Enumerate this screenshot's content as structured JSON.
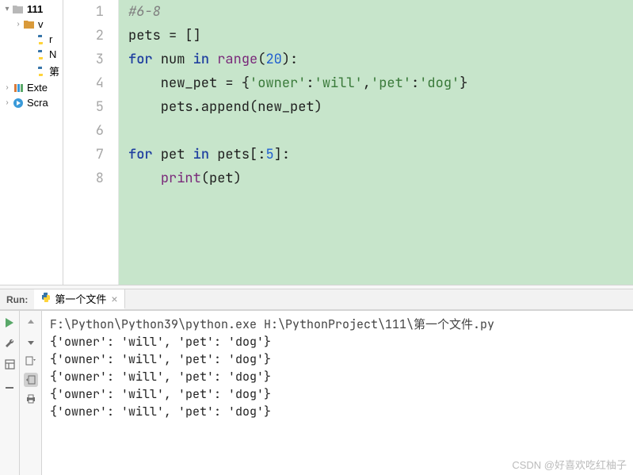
{
  "sidebar": {
    "items": [
      {
        "label": "111",
        "icon": "folder-open",
        "chev": "▾",
        "bold": true
      },
      {
        "label": "v",
        "icon": "folder-orange",
        "chev": "›",
        "indent": 1
      },
      {
        "label": "r",
        "icon": "python",
        "indent": 2
      },
      {
        "label": "N",
        "icon": "python",
        "indent": 2
      },
      {
        "label": "第",
        "icon": "python",
        "indent": 2
      },
      {
        "label": "Exte",
        "icon": "lib",
        "chev": "›"
      },
      {
        "label": "Scra",
        "icon": "scratch",
        "chev": "›"
      }
    ]
  },
  "editor": {
    "lines": [
      {
        "n": "1",
        "tokens": [
          {
            "t": "#6-8",
            "c": "c-comment"
          }
        ]
      },
      {
        "n": "2",
        "tokens": [
          {
            "t": "pets ",
            "c": "c-text"
          },
          {
            "t": "= []",
            "c": "c-punct"
          }
        ]
      },
      {
        "n": "3",
        "tokens": [
          {
            "t": "for ",
            "c": "c-kw"
          },
          {
            "t": "num ",
            "c": "c-text"
          },
          {
            "t": "in ",
            "c": "c-kw"
          },
          {
            "t": "range",
            "c": "c-builtin"
          },
          {
            "t": "(",
            "c": "c-punct"
          },
          {
            "t": "20",
            "c": "c-num"
          },
          {
            "t": "):",
            "c": "c-punct"
          }
        ]
      },
      {
        "n": "4",
        "tokens": [
          {
            "t": "    new_pet ",
            "c": "c-text"
          },
          {
            "t": "= {",
            "c": "c-punct"
          },
          {
            "t": "'owner'",
            "c": "c-str"
          },
          {
            "t": ":",
            "c": "c-punct"
          },
          {
            "t": "'will'",
            "c": "c-str"
          },
          {
            "t": ",",
            "c": "c-punct"
          },
          {
            "t": "'pet'",
            "c": "c-str"
          },
          {
            "t": ":",
            "c": "c-punct"
          },
          {
            "t": "'dog'",
            "c": "c-str"
          },
          {
            "t": "}",
            "c": "c-punct"
          }
        ]
      },
      {
        "n": "5",
        "tokens": [
          {
            "t": "    pets.append(new_pet)",
            "c": "c-text"
          }
        ]
      },
      {
        "n": "6",
        "tokens": []
      },
      {
        "n": "7",
        "tokens": [
          {
            "t": "for ",
            "c": "c-kw"
          },
          {
            "t": "pet ",
            "c": "c-text"
          },
          {
            "t": "in ",
            "c": "c-kw"
          },
          {
            "t": "pets[:",
            "c": "c-text"
          },
          {
            "t": "5",
            "c": "c-num"
          },
          {
            "t": "]:",
            "c": "c-punct"
          }
        ]
      },
      {
        "n": "8",
        "tokens": [
          {
            "t": "    ",
            "c": "c-text"
          },
          {
            "t": "print",
            "c": "c-builtin"
          },
          {
            "t": "(pet)",
            "c": "c-text"
          }
        ]
      }
    ]
  },
  "run": {
    "label": "Run:",
    "tab": {
      "name": "第一个文件",
      "close": "×"
    },
    "path": "F:\\Python\\Python39\\python.exe H:\\PythonProject\\111\\第一个文件.py",
    "output": [
      "{'owner': 'will', 'pet': 'dog'}",
      "{'owner': 'will', 'pet': 'dog'}",
      "{'owner': 'will', 'pet': 'dog'}",
      "{'owner': 'will', 'pet': 'dog'}",
      "{'owner': 'will', 'pet': 'dog'}"
    ]
  },
  "watermark": "CSDN @好喜欢吃红柚子"
}
